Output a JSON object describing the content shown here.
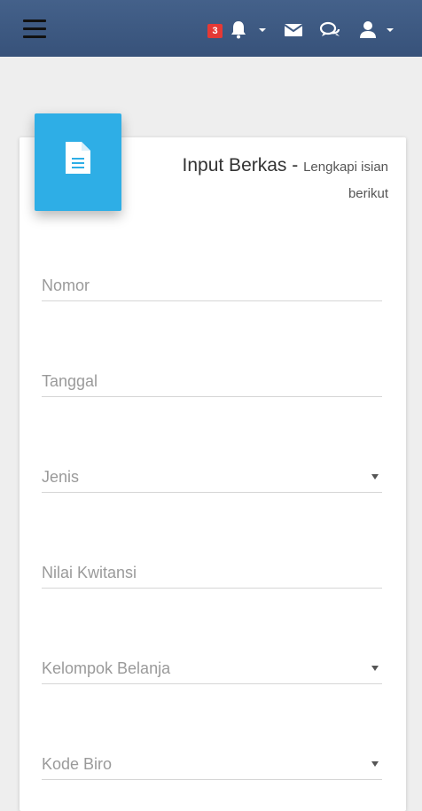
{
  "topbar": {
    "notification_count": "3",
    "icons": [
      "menu-icon",
      "bell-icon",
      "envelope-icon",
      "chat-icon",
      "user-icon"
    ]
  },
  "card": {
    "title": "Input Berkas",
    "separator": " - ",
    "subtitle": "Lengkapi isian berikut",
    "icon": "document-icon",
    "accent_color": "#2eaee6"
  },
  "form": {
    "fields": [
      {
        "label": "Nomor",
        "type": "text"
      },
      {
        "label": "Tanggal",
        "type": "text"
      },
      {
        "label": "Jenis",
        "type": "select"
      },
      {
        "label": "Nilai Kwitansi",
        "type": "text"
      },
      {
        "label": "Kelompok Belanja",
        "type": "select"
      },
      {
        "label": "Kode Biro",
        "type": "select"
      }
    ]
  }
}
